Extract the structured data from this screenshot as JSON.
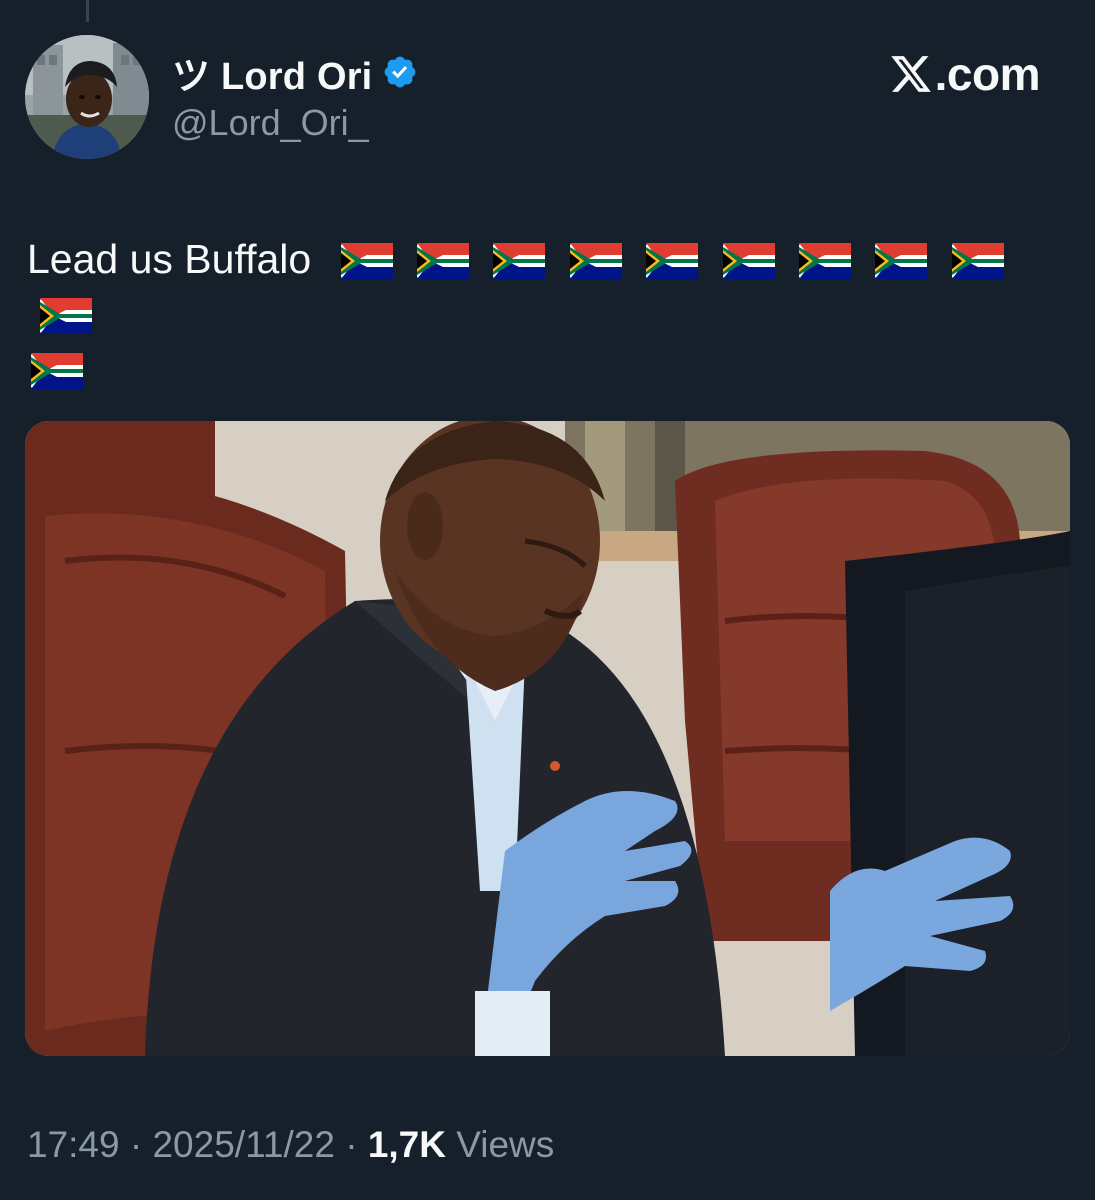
{
  "author": {
    "display_name": "ツ Lord Ori",
    "handle": "@Lord_Ori_",
    "verified": true
  },
  "brand": {
    "text": ".com",
    "icon": "x-logo-icon"
  },
  "tweet": {
    "text": "Lead us Buffalo",
    "flag_emoji": "🇿🇦",
    "flag_count": 11,
    "media_description_icon": "photo"
  },
  "meta": {
    "time": "17:49",
    "sep1": " · ",
    "date": "2025/11/22",
    "sep2": " · ",
    "views_count": "1,7K",
    "views_label": " Views"
  },
  "colors": {
    "background": "#15202b",
    "text_primary": "#f7f9f9",
    "text_secondary": "#8b98a5",
    "verified_blue": "#1d9bf0"
  }
}
